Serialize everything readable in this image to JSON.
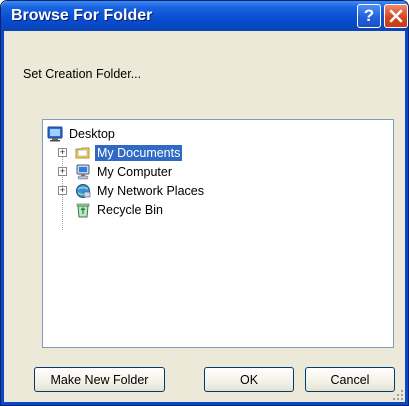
{
  "window": {
    "title": "Browse For Folder",
    "help_symbol": "?",
    "prompt": "Set Creation Folder..."
  },
  "tree": {
    "root": {
      "label": "Desktop",
      "icon": "desktop-icon"
    },
    "items": [
      {
        "label": "My Documents",
        "icon": "folder-icon",
        "expandable": true,
        "selected": true
      },
      {
        "label": "My Computer",
        "icon": "computer-icon",
        "expandable": true,
        "selected": false
      },
      {
        "label": "My Network Places",
        "icon": "network-places-icon",
        "expandable": true,
        "selected": false
      },
      {
        "label": "Recycle Bin",
        "icon": "recycle-bin-icon",
        "expandable": false,
        "selected": false
      }
    ],
    "expander_symbol": "+"
  },
  "buttons": {
    "make_new_folder": "Make New Folder",
    "ok": "OK",
    "cancel": "Cancel"
  },
  "colors": {
    "titlebar": "#0a4fd3",
    "selection": "#316ac5",
    "dialog_face": "#ece9d8"
  }
}
